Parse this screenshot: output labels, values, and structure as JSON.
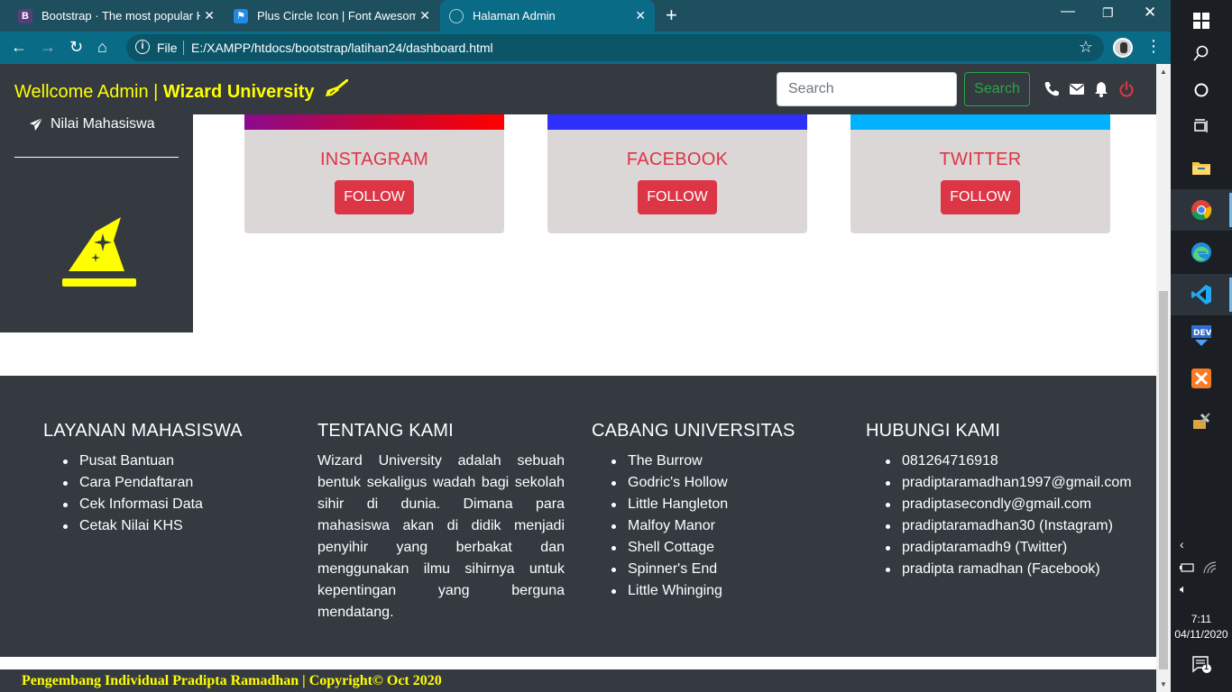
{
  "browser": {
    "tabs": [
      {
        "title": "Bootstrap · The most popular HTML",
        "favicon": "bootstrap-icon",
        "color": "#563d7c",
        "glyph": "B"
      },
      {
        "title": "Plus Circle Icon | Font Awesome",
        "favicon": "font-awesome-flag-icon",
        "color": "#228ae6",
        "glyph": "⚑"
      },
      {
        "title": "Halaman Admin",
        "favicon": "globe-icon",
        "color": "#0a6b86",
        "glyph": "◎"
      }
    ],
    "new_tab": "+",
    "address": {
      "scheme": "File",
      "url": "E:/XAMPP/htdocs/bootstrap/latihan24/dashboard.html"
    }
  },
  "navbar": {
    "brand_prefix": "Wellcome Admin | ",
    "brand_name": "Wizard University",
    "brand_icon": "broom-icon",
    "search_placeholder": "Search",
    "search_button": "Search",
    "icons": [
      "phone-icon",
      "envelope-icon",
      "bell-icon",
      "power-icon"
    ],
    "power_color": "#dc3545"
  },
  "sidebar": {
    "item_label": "Nilai Mahasiswa",
    "item_icon": "paper-plane-icon",
    "logo": "wizard-hat-icon",
    "logo_color": "#ffff00"
  },
  "social": [
    {
      "name": "INSTAGRAM",
      "button": "FOLLOW"
    },
    {
      "name": "FACEBOOK",
      "button": "FOLLOW"
    },
    {
      "name": "TWITTER",
      "button": "FOLLOW"
    }
  ],
  "footer": {
    "layanan": {
      "title": "LAYANAN MAHASISWA",
      "items": [
        "Pusat Bantuan",
        "Cara Pendaftaran",
        "Cek Informasi Data",
        "Cetak Nilai KHS"
      ]
    },
    "tentang": {
      "title": "TENTANG KAMI",
      "text": "Wizard University adalah sebuah bentuk sekaligus wadah bagi sekolah sihir di dunia. Dimana para mahasiswa akan di didik menjadi penyihir yang berbakat dan menggunakan ilmu sihirnya untuk kepentingan yang berguna mendatang."
    },
    "cabang": {
      "title": "CABANG UNIVERSITAS",
      "items": [
        "The Burrow",
        "Godric's Hollow",
        "Little Hangleton",
        "Malfoy Manor",
        "Shell Cottage",
        "Spinner's End",
        "Little Whinging"
      ]
    },
    "hubungi": {
      "title": "HUBUNGI KAMI",
      "items": [
        "081264716918",
        "pradiptaramadhan1997@gmail.com",
        "pradiptasecondly@gmail.com",
        "pradiptaramadhan30 (Instagram)",
        "pradiptaramadh9 (Twitter)",
        "pradipta ramadhan (Facebook)"
      ]
    },
    "credit": "Pengembang Individual Pradipta Ramadhan | Copyright© Oct 2020"
  },
  "taskbar": {
    "time": "7:11",
    "date": "04/11/2020",
    "notifications": "1"
  }
}
